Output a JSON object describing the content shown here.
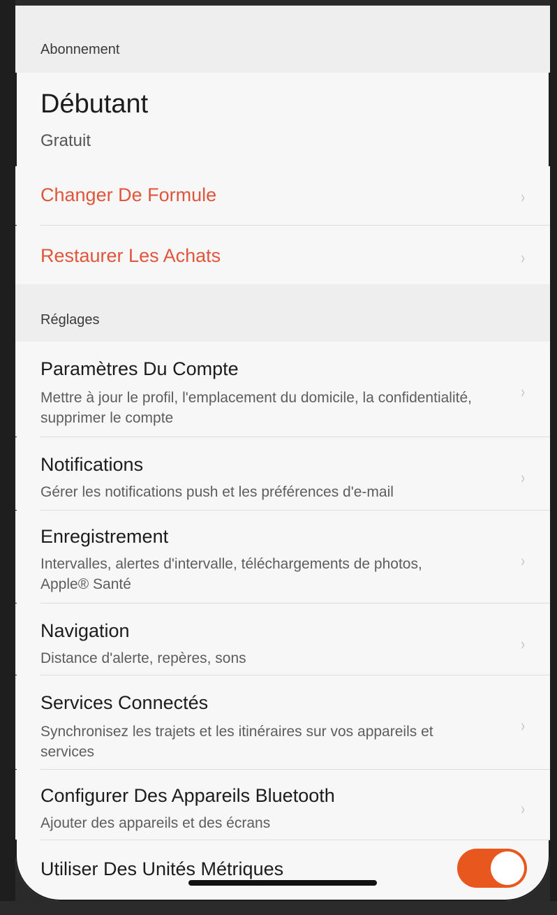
{
  "subscription": {
    "header": "Abonnement",
    "plan_name": "Débutant",
    "plan_price": "Gratuit",
    "change_plan": "Changer De Formule",
    "restore_purchases": "Restaurer Les Achats"
  },
  "settings": {
    "header": "Réglages",
    "items": [
      {
        "title": "Paramètres Du Compte",
        "subtitle": "Mettre à jour le profil, l'emplacement du domicile, la confidentialité, supprimer le compte"
      },
      {
        "title": "Notifications",
        "subtitle": "Gérer les notifications push et les préférences d'e-mail"
      },
      {
        "title": "Enregistrement",
        "subtitle": "Intervalles, alertes d'intervalle, téléchargements de photos, Apple® Santé"
      },
      {
        "title": "Navigation",
        "subtitle": "Distance d'alerte, repères, sons"
      },
      {
        "title": "Services Connectés",
        "subtitle": "Synchronisez les trajets et les itinéraires sur vos appareils et services"
      },
      {
        "title": "Configurer Des Appareils Bluetooth",
        "subtitle": "Ajouter des appareils et des écrans"
      }
    ],
    "metric_units": {
      "label": "Utiliser Des Unités Métriques",
      "enabled": true
    }
  },
  "icons": {
    "chevron": "›"
  },
  "colors": {
    "accent": "#e0553c",
    "toggle_on": "#e8571d"
  }
}
